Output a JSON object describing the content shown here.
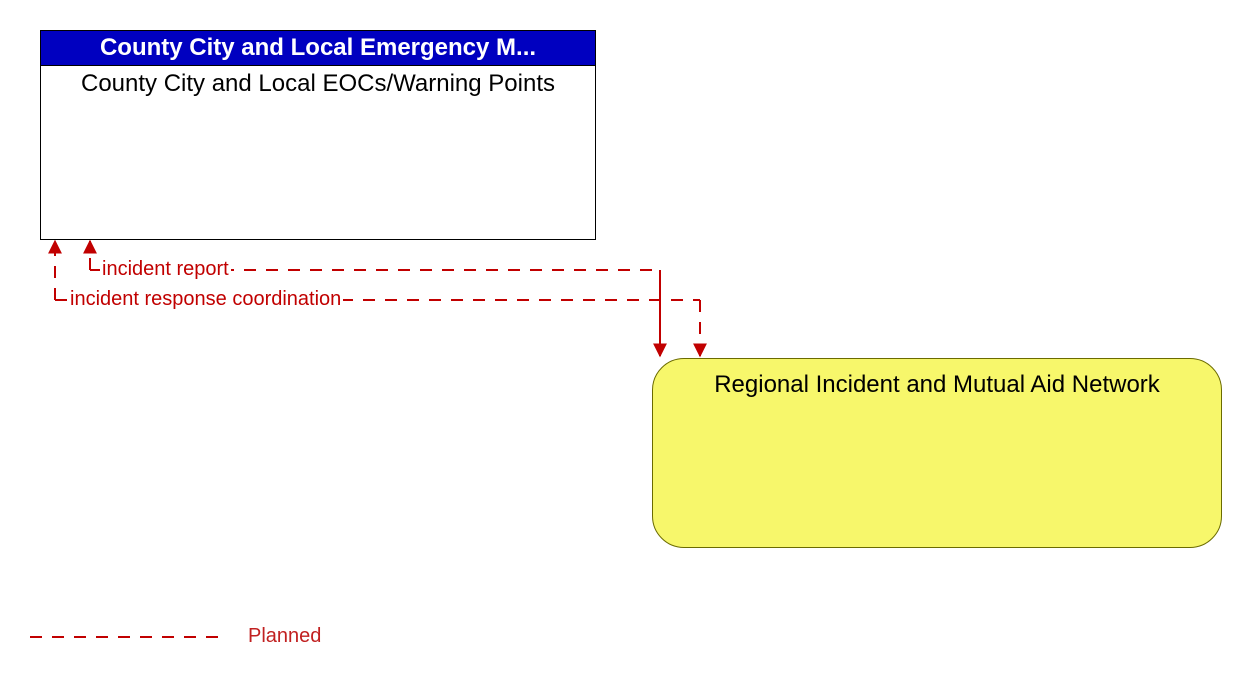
{
  "nodes": {
    "eoc": {
      "header": "County City and Local Emergency M...",
      "body": "County City and Local EOCs/Warning Points"
    },
    "regional": {
      "body": "Regional Incident and Mutual Aid Network"
    }
  },
  "flows": {
    "flow1": "incident report",
    "flow2": "incident response coordination"
  },
  "legend": {
    "planned": "Planned"
  },
  "colors": {
    "headerBg": "#0000c0",
    "headerText": "#ffffff",
    "yellowFill": "#f7f76b",
    "yellowStroke": "#6b6b00",
    "flowLine": "#c10000",
    "legendText": "#c12020"
  }
}
